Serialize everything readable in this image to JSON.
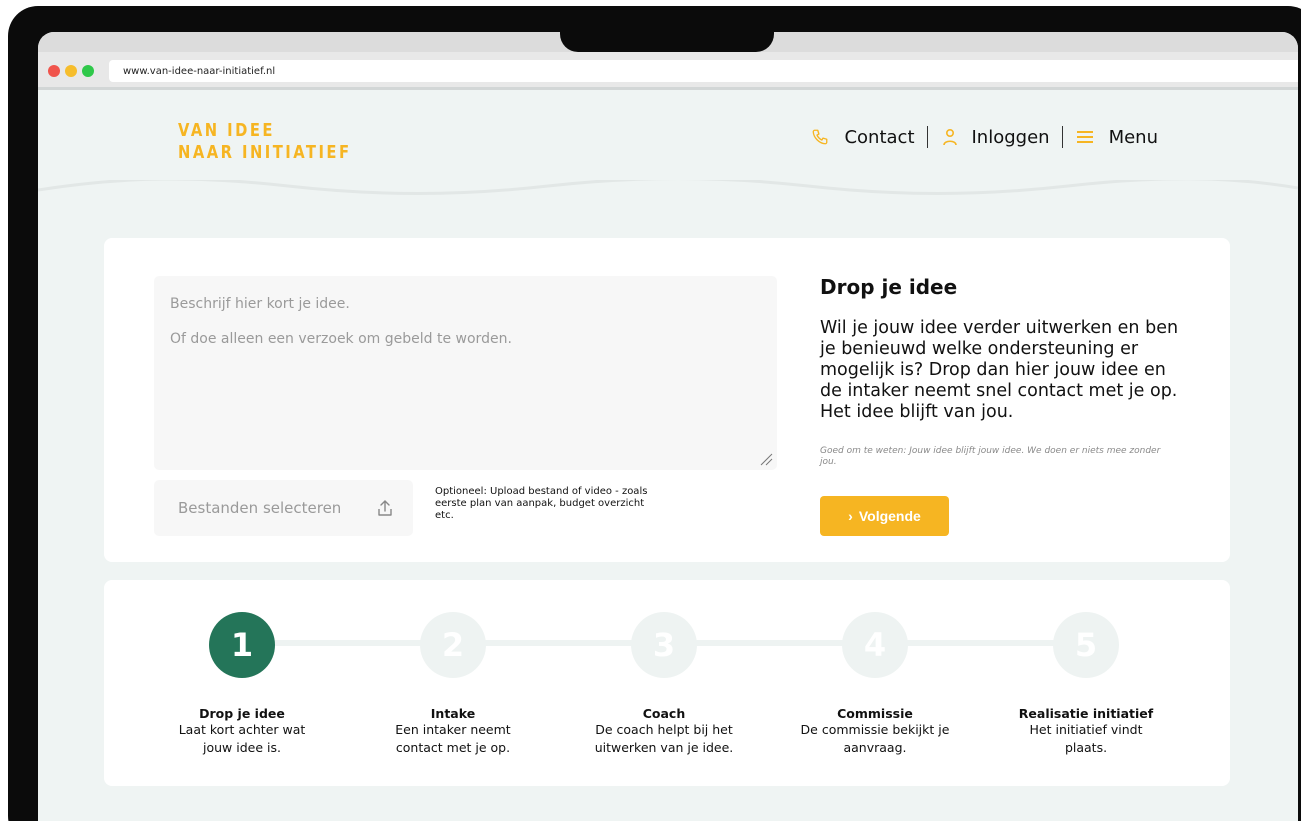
{
  "browser": {
    "url": "www.van-idee-naar-initiatief.nl"
  },
  "header": {
    "logo_line1": "VAN IDEE",
    "logo_line2": "NAAR INITIATIEF",
    "nav": [
      {
        "label": "Contact",
        "icon": "phone-icon"
      },
      {
        "label": "Inloggen",
        "icon": "user-icon"
      },
      {
        "label": "Menu",
        "icon": "hamburger-icon"
      }
    ]
  },
  "form": {
    "placeholder_line1": "Beschrijf hier kort je idee.",
    "placeholder_line2": "Of doe alleen een verzoek om gebeld te worden.",
    "file_button_label": "Bestanden selecteren",
    "upload_hint": "Optioneel: Upload bestand of video - zoals eerste plan van aanpak, budget overzicht etc."
  },
  "intro": {
    "title": "Drop je idee",
    "text": "Wil je jouw idee verder uitwerken en ben je benieuwd welke ondersteuning er mogelijk is? Drop dan hier jouw idee en de intaker neemt snel contact met je op. Het idee blijft van jou.",
    "note": "Goed om te weten: Jouw idee blijft jouw idee. We doen er niets mee zonder jou.",
    "next_label": "Volgende"
  },
  "steps": [
    {
      "number": "1",
      "title": "Drop je idee",
      "desc": "Laat kort achter wat jouw idee is.",
      "active": true
    },
    {
      "number": "2",
      "title": "Intake",
      "desc": "Een intaker neemt contact met je op.",
      "active": false
    },
    {
      "number": "3",
      "title": "Coach",
      "desc": "De coach helpt bij het uitwerken van je idee.",
      "active": false
    },
    {
      "number": "4",
      "title": "Commissie",
      "desc": "De commissie bekijkt je aanvraag.",
      "active": false
    },
    {
      "number": "5",
      "title": "Realisatie initiatief",
      "desc": "Het initiatief vindt plaats.",
      "active": false
    }
  ],
  "colors": {
    "accent": "#f6b522",
    "active_step": "#247559",
    "page_bg": "#eff4f3"
  }
}
